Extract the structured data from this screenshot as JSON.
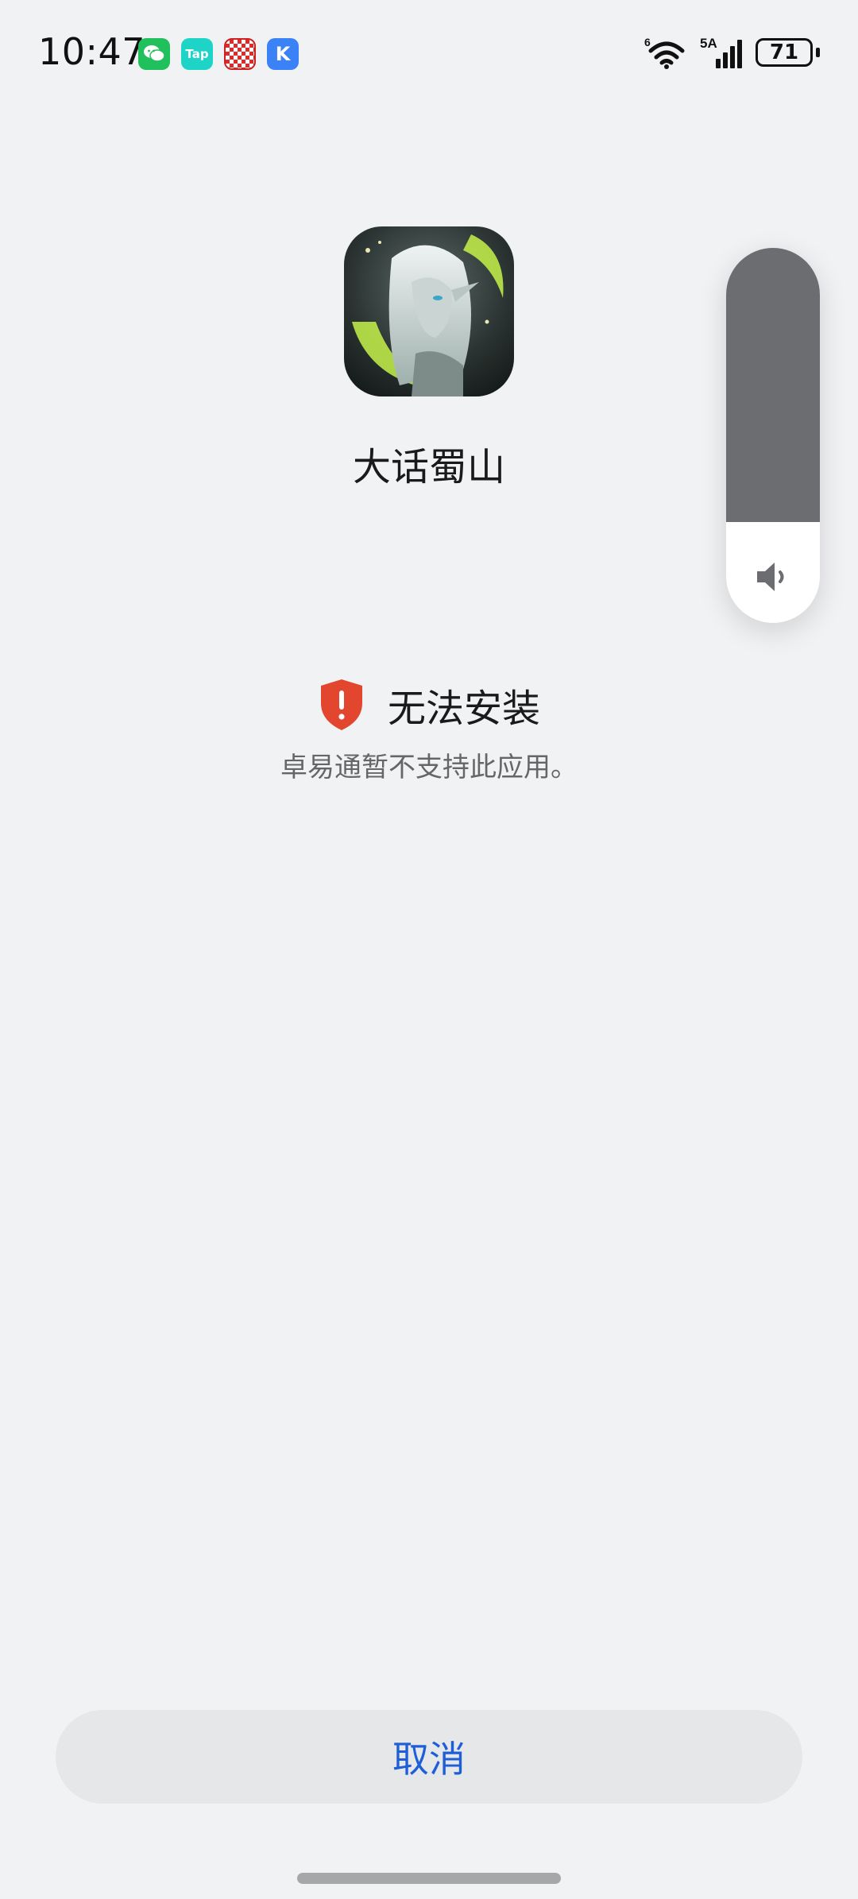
{
  "status_bar": {
    "time": "10:47",
    "notifications": [
      {
        "name": "wechat-notification-icon",
        "label": ""
      },
      {
        "name": "taptap-notification-icon",
        "label": "Tap"
      },
      {
        "name": "red-app-notification-icon",
        "label": ""
      },
      {
        "name": "k-app-notification-icon",
        "label": "K"
      }
    ],
    "wifi_label": "6",
    "signal_label": "5A",
    "battery": "71"
  },
  "app": {
    "name": "大话蜀山",
    "icon": "game-character-artwork"
  },
  "error": {
    "title": "无法安装",
    "description": "卓易通暂不支持此应用。",
    "icon": "shield-alert-icon",
    "color": "#e2462f"
  },
  "volume": {
    "level": 0.73,
    "icon": "speaker-icon"
  },
  "actions": {
    "cancel_label": "取消",
    "accent": "#1e5fd8"
  }
}
